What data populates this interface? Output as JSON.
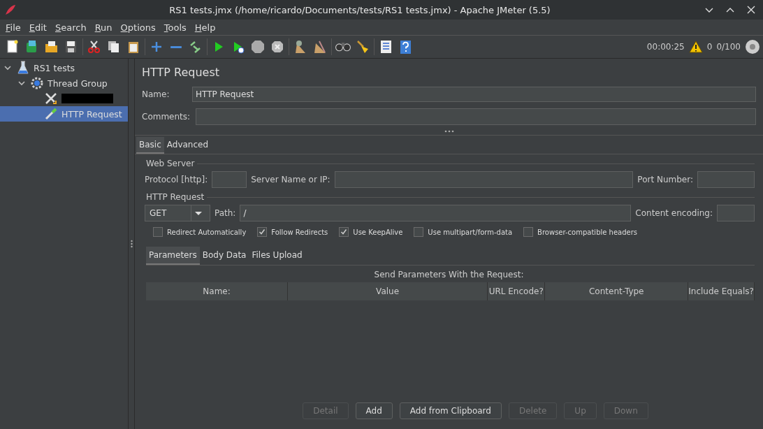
{
  "window": {
    "title": "RS1 tests.jmx (/home/ricardo/Documents/tests/RS1 tests.jmx) - Apache JMeter (5.5)"
  },
  "menu": [
    "File",
    "Edit",
    "Search",
    "Run",
    "Options",
    "Tools",
    "Help"
  ],
  "status": {
    "elapsed": "00:00:25",
    "warnings": "0",
    "threads": "0/100"
  },
  "tree": [
    {
      "label": "RS1 tests",
      "kind": "plan",
      "expanded": true,
      "selected": false,
      "children": [
        {
          "label": "Thread Group",
          "kind": "group",
          "expanded": true,
          "selected": false,
          "children": [
            {
              "kind": "redacted",
              "selected": false
            },
            {
              "label": "HTTP Request",
              "kind": "sampler",
              "selected": true
            }
          ]
        }
      ]
    }
  ],
  "panel": {
    "title": "HTTP Request",
    "name_label": "Name:",
    "name_value": "HTTP Request",
    "comments_label": "Comments:"
  },
  "tabs": [
    {
      "label": "Basic",
      "selected": true
    },
    {
      "label": "Advanced",
      "selected": false
    }
  ],
  "web_server": {
    "legend": "Web Server",
    "protocol_label": "Protocol [http]:",
    "server_label": "Server Name or IP:",
    "port_label": "Port Number:"
  },
  "http_request": {
    "legend": "HTTP Request",
    "method": "GET",
    "path_label": "Path:",
    "path_value": "/",
    "encoding_label": "Content encoding:"
  },
  "options": [
    {
      "label": "Redirect Automatically",
      "checked": false
    },
    {
      "label": "Follow Redirects",
      "checked": true
    },
    {
      "label": "Use KeepAlive",
      "checked": true
    },
    {
      "label": "Use multipart/form-data",
      "checked": false
    },
    {
      "label": "Browser-compatible headers",
      "checked": false
    }
  ],
  "sub_tabs": [
    {
      "label": "Parameters",
      "selected": true
    },
    {
      "label": "Body Data",
      "selected": false
    },
    {
      "label": "Files Upload",
      "selected": false
    }
  ],
  "table": {
    "caption": "Send Parameters With the Request:",
    "columns": [
      "Name:",
      "Value",
      "URL Encode?",
      "Content-Type",
      "Include Equals?"
    ]
  },
  "buttons": [
    {
      "label": "Detail",
      "disabled": true
    },
    {
      "label": "Add",
      "disabled": false
    },
    {
      "label": "Add from Clipboard",
      "disabled": false
    },
    {
      "label": "Delete",
      "disabled": true
    },
    {
      "label": "Up",
      "disabled": true
    },
    {
      "label": "Down",
      "disabled": true
    }
  ]
}
